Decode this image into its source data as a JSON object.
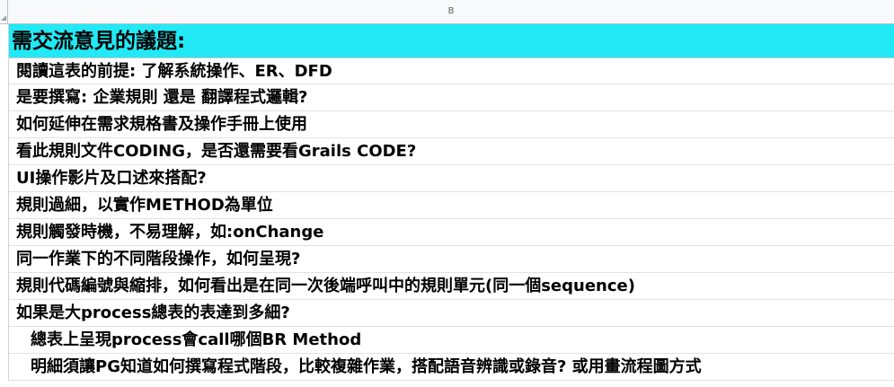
{
  "spreadsheet": {
    "column_header": "B",
    "accent_color": "#22e9f5"
  },
  "rows": [
    "需交流意見的議題:",
    "閱讀這表的前提:   了解系統操作、ER、DFD",
    "是要撰寫: 企業規則 還是 翻譯程式邏輯?",
    "如何延伸在需求規格書及操作手冊上使用",
    "看此規則文件CODING，是否還需要看Grails CODE?",
    "UI操作影片及口述來搭配?",
    "規則過細，以實作METHOD為單位",
    "規則觸發時機，不易理解，如:onChange",
    "同一作業下的不同階段操作，如何呈現?",
    "規則代碼編號與縮排，如何看出是在同一次後端呼叫中的規則單元(同一個sequence)",
    "如果是大process總表的表達到多細?",
    "總表上呈現process會call哪個BR Method",
    "明細須讓PG知道如何撰寫程式階段，比較複雜作業，搭配語音辨識或錄音? 或用畫流程圖方式"
  ]
}
